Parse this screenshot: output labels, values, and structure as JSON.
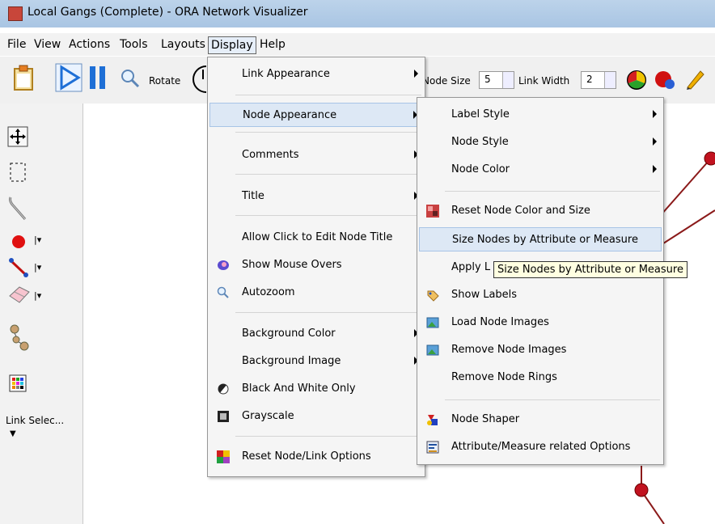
{
  "window": {
    "title": "Local Gangs (Complete) - ORA Network Visualizer"
  },
  "menubar": [
    "File",
    "View",
    "Actions",
    "Tools",
    "Layouts",
    "Display",
    "Help"
  ],
  "toolbar": {
    "rotate_label": "Rotate",
    "node_size_label": "Node Size",
    "node_size_value": "5",
    "link_width_label": "Link Width",
    "link_width_value": "2"
  },
  "left_toolbar": {
    "link_select_label": "Link Selec..."
  },
  "display_menu": [
    {
      "label": "Link Appearance",
      "submenu": true,
      "icon": ""
    },
    {
      "label": "Node Appearance",
      "submenu": true,
      "icon": "",
      "highlighted": true
    },
    {
      "label": "Comments",
      "submenu": true,
      "icon": ""
    },
    {
      "label": "Title",
      "submenu": true,
      "icon": ""
    },
    {
      "label": "Allow Click to Edit Node Title",
      "submenu": false,
      "icon": ""
    },
    {
      "label": "Show Mouse Overs",
      "submenu": false,
      "icon": "eye-icon"
    },
    {
      "label": "Autozoom",
      "submenu": false,
      "icon": "magnifier-icon"
    },
    {
      "label": "Background Color",
      "submenu": true,
      "icon": ""
    },
    {
      "label": "Background Image",
      "submenu": true,
      "icon": ""
    },
    {
      "label": "Black And White Only",
      "submenu": false,
      "icon": "bw-icon"
    },
    {
      "label": "Grayscale",
      "submenu": false,
      "icon": "grayscale-icon"
    },
    {
      "label": "Reset Node/Link Options",
      "submenu": false,
      "icon": "reset-icon"
    }
  ],
  "node_appearance_menu": [
    {
      "label": "Label Style",
      "submenu": true,
      "icon": ""
    },
    {
      "label": "Node Style",
      "submenu": true,
      "icon": ""
    },
    {
      "label": "Node Color",
      "submenu": true,
      "icon": ""
    },
    {
      "label": "Reset Node Color and Size",
      "submenu": false,
      "icon": "reset-color-icon"
    },
    {
      "label": "Size Nodes by Attribute or Measure",
      "submenu": false,
      "icon": "",
      "highlighted": true
    },
    {
      "label": "Apply L",
      "submenu": false,
      "icon": ""
    },
    {
      "label": "Show Labels",
      "submenu": false,
      "icon": "label-tag-icon"
    },
    {
      "label": "Load Node Images",
      "submenu": false,
      "icon": "load-image-icon"
    },
    {
      "label": "Remove Node Images",
      "submenu": false,
      "icon": "remove-image-icon"
    },
    {
      "label": "Remove Node Rings",
      "submenu": false,
      "icon": ""
    },
    {
      "label": "Node Shaper",
      "submenu": false,
      "icon": "shapes-icon"
    },
    {
      "label": "Attribute/Measure related Options",
      "submenu": false,
      "icon": "attribute-icon"
    }
  ],
  "tooltip": "Size Nodes by Attribute or Measure",
  "colors": {
    "node": "#c1121f",
    "link": "#8b1a1a",
    "highlight": "#dde8f5"
  }
}
